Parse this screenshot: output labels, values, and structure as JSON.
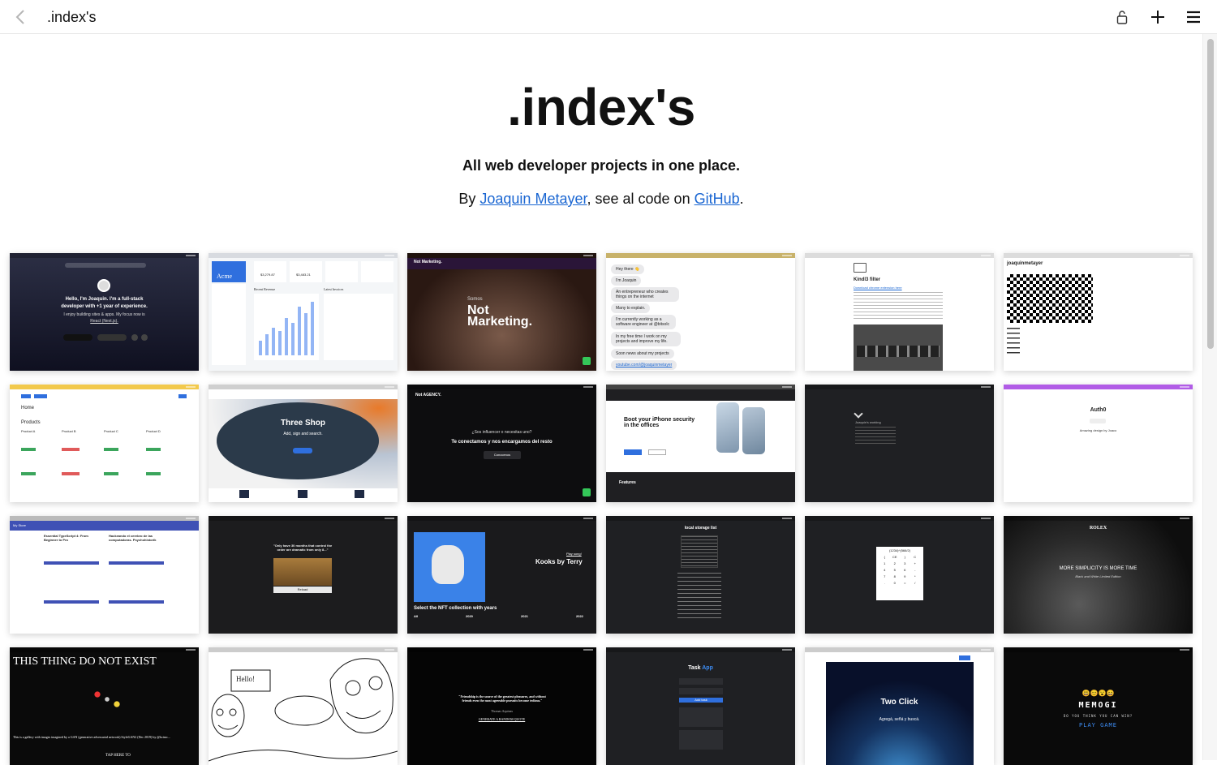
{
  "browser": {
    "title": ".index's"
  },
  "hero": {
    "title": ".index's",
    "tagline": "All web developer projects in one place.",
    "by_prefix": "By ",
    "author_link": "Joaquin Metayer",
    "middle": ", see al code on ",
    "github_link": "GitHub",
    "suffix": "."
  },
  "cards": {
    "c1": {
      "line1": "Hello, I'm Joaquin. I'm a full-stack",
      "line2": "developer with +1 year of experience.",
      "line3": "I enjoy building sites & apps. My focus now is",
      "line4": "React (Next.js)."
    },
    "c2": {
      "brand": "Acme",
      "section1": "Recent Revenue",
      "section2": "Latest Invoices",
      "stat1": "$3,279.87",
      "stat2": "$3,483.21"
    },
    "c3": {
      "top": "Not Marketing.",
      "small": "Somos",
      "big1": "Not",
      "big2": "Marketing."
    },
    "c4": {
      "b1": "Hey there 👋",
      "b2": "I'm Joaquin",
      "b3": "An entrepreneur who creates things on the internet",
      "b4": "Many to explain.",
      "b5": "I'm currently working as a software engineer at @bitsolc",
      "b6": "In my free time I work on my projects and improve my life.",
      "b7": "Soon news about my projects",
      "b8": "youtube.com/@joaquinmetayer"
    },
    "c5": {
      "title": "Kindl3 filter",
      "link": "Download chrome extension here"
    },
    "c6": {
      "name": "joaquinmetayer"
    },
    "c7": {
      "home": "Home",
      "products": "Products",
      "p1": "Product A",
      "p2": "Product B",
      "p3": "Product C",
      "p4": "Product D"
    },
    "c8": {
      "title": "Three Shop",
      "sub": "Add, sign and search."
    },
    "c9": {
      "top": "Not AGENCY.",
      "line1": "¿Sos influencer o necesitas uno?",
      "line2": "Te conectamos y nos encargamos del resto",
      "btn": "Conocenos"
    },
    "c10": {
      "headline": "Boot your iPhone security in the offices",
      "features": "Features"
    },
    "c11": {
      "line": "Joaquin's working"
    },
    "c12": {
      "title": "Auth0",
      "sub": "Amazing design by Joaco"
    },
    "c13": {
      "header": "My Store",
      "item1": "Essential TypeScript 4: From Beginner to Pro",
      "item2": "Hackeando el cerebro de las computadoras. Psychohistorik"
    },
    "c14": {
      "quote": "\"Only have 30 months that control the order are dramatic from only 8...\"",
      "btn": "Reload"
    },
    "c15": {
      "title": "Kooks by Terry",
      "play": "Play song!",
      "foot": "Select the NFT collection with years",
      "y1": "All",
      "y2": "2020",
      "y3": "2021",
      "y4": "2022"
    },
    "c16": {
      "title": "local storage list"
    },
    "c17": {
      "display": "(1234)^(566/2)",
      "keys": [
        "(",
        "CE",
        ")",
        "C",
        "1",
        "2",
        "3",
        "+",
        "4",
        "5",
        "6",
        "-",
        "7",
        "8",
        "9",
        "*",
        ".",
        "0",
        "=",
        "/"
      ]
    },
    "c18": {
      "brand": "ROLEX",
      "headline": "MORE SIMPLICITY IS MORE TIME",
      "sub": "Black and White Limited Edition"
    },
    "c19": {
      "title": "THIS THING DO NOT EXIST",
      "body": "This is a gallery with images imagined by a GAN (generative adversarial network) StyleGAN2 (Dec 2019) by @kcimc...",
      "tap": "TAP HERE TO"
    },
    "c20": {
      "hello": "Hello!"
    },
    "c21": {
      "quote": "\"Friendship is the source of the greatest pleasures, and without friends even the most agreeable pursuits become tedious.\"",
      "author": "Thomas Aquinas",
      "btn": "GENERATE A RANDOM QUOTE"
    },
    "c22": {
      "title1": "Task ",
      "title2": "App",
      "btn": "Add task"
    },
    "c23": {
      "title": "Two Click",
      "sub": "Agregá, señá y buscá."
    },
    "c24": {
      "emoji": "😃😊😮😄",
      "title": "MEMOGI",
      "sub": "DO YOU THINK YOU CAN WIN?",
      "btn": "PLAY GAME"
    }
  }
}
